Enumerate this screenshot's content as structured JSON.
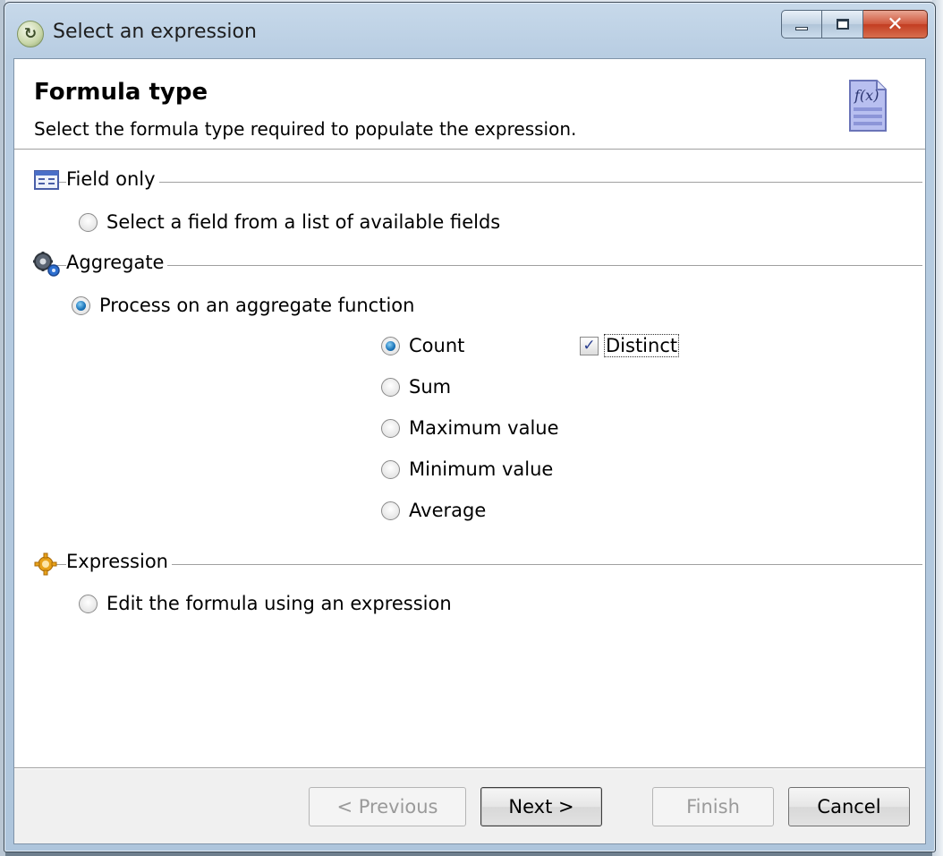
{
  "window": {
    "title": "Select an expression",
    "minimize": "minimize",
    "maximize": "maximize",
    "close": "✕"
  },
  "header": {
    "title": "Formula type",
    "subtitle": "Select the formula type required to populate the expression.",
    "icon_text": "f(x)"
  },
  "sections": {
    "field_only": {
      "label": "Field only",
      "option": "Select a field from a list of available fields",
      "selected": false
    },
    "aggregate": {
      "label": "Aggregate",
      "option": "Process on an aggregate function",
      "selected": true,
      "functions": [
        {
          "label": "Count",
          "selected": true
        },
        {
          "label": "Sum",
          "selected": false
        },
        {
          "label": "Maximum value",
          "selected": false
        },
        {
          "label": "Minimum value",
          "selected": false
        },
        {
          "label": "Average",
          "selected": false
        }
      ],
      "distinct": {
        "label": "Distinct",
        "checked": true
      }
    },
    "expression": {
      "label": "Expression",
      "option": "Edit the formula using an expression",
      "selected": false
    }
  },
  "footer": {
    "previous": "< Previous",
    "next": "Next >",
    "finish": "Finish",
    "cancel": "Cancel"
  },
  "icons": {
    "app": "refresh-icon",
    "field_only": "table-icon",
    "aggregate": "gears-icon",
    "expression": "gear-yellow-icon",
    "header": "function-document-icon"
  },
  "colors": {
    "radio_accent": "#1a73b8",
    "close_button": "#c23d21",
    "title_bar": "#b8cde2"
  }
}
